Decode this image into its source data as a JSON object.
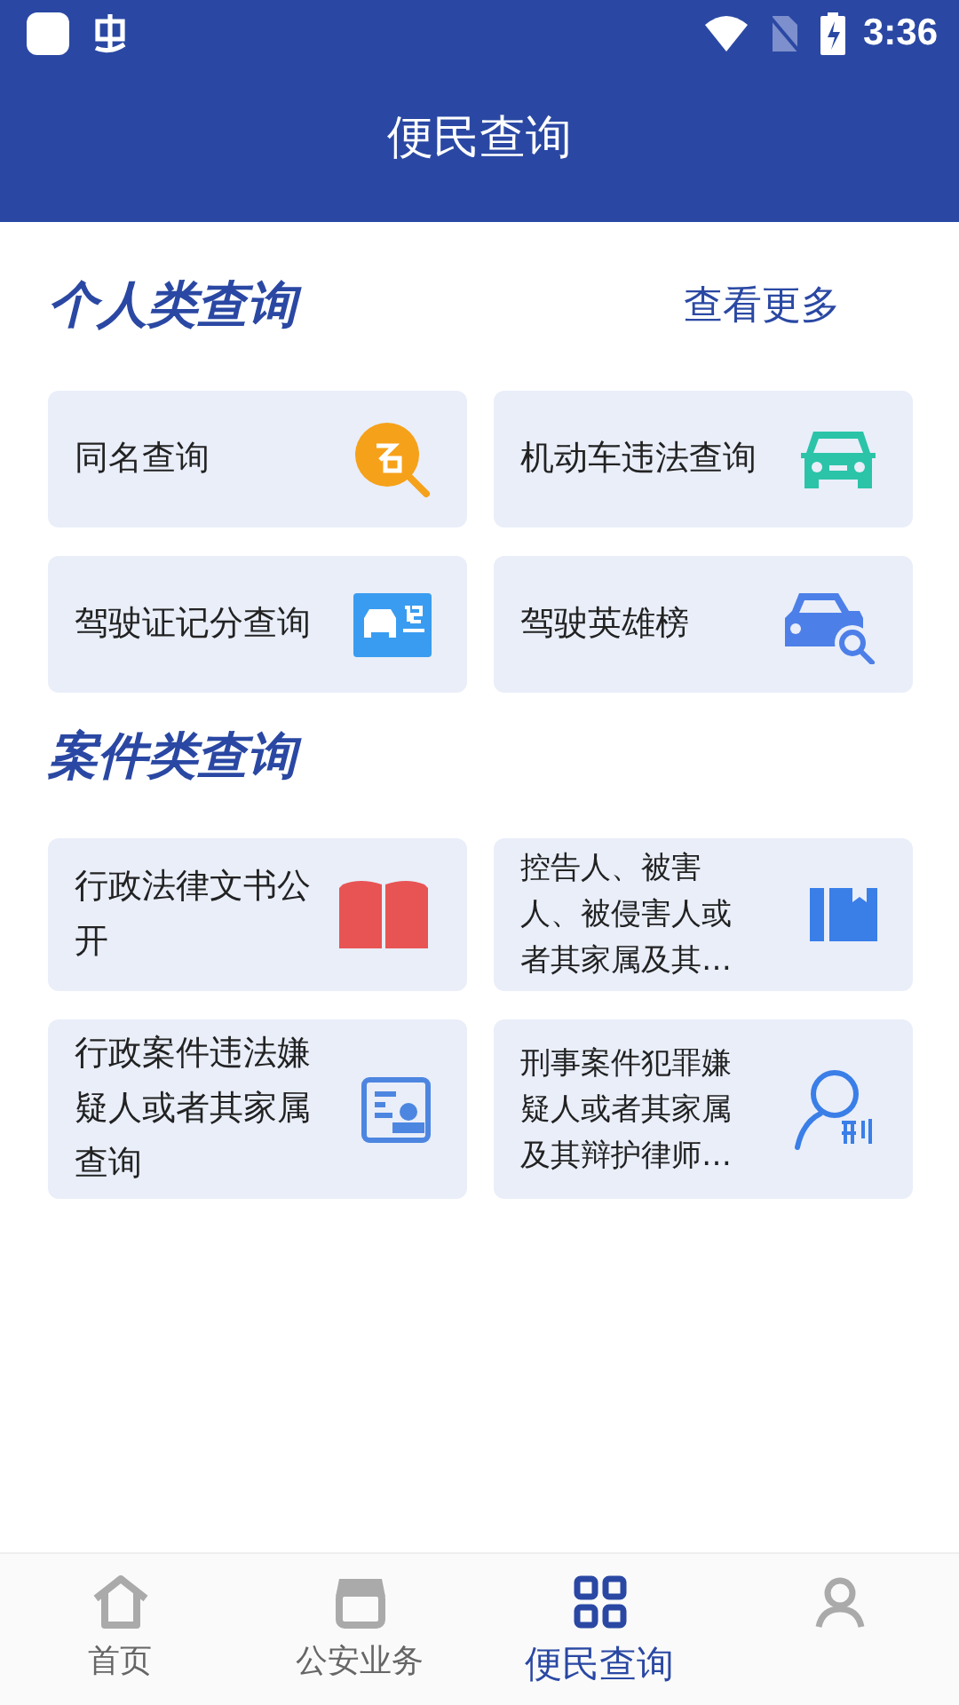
{
  "status_bar": {
    "time": "3:36"
  },
  "header": {
    "title": "便民查询"
  },
  "sections": [
    {
      "title": "个人类查询",
      "more": "查看更多",
      "items": [
        {
          "label": "同名查询",
          "kind": "name-search"
        },
        {
          "label": "机动车违法查询",
          "kind": "car"
        },
        {
          "label": "驾驶证记分查询",
          "kind": "license"
        },
        {
          "label": "驾驶英雄榜",
          "kind": "car-search"
        }
      ]
    },
    {
      "title": "案件类查询",
      "items": [
        {
          "label": "行政法律文书公开",
          "kind": "law-book"
        },
        {
          "label": "控告人、被害人、被侵害人或者其家属及其…",
          "kind": "bookmark",
          "small": true
        },
        {
          "label": "行政案件违法嫌疑人或者其家属查询",
          "kind": "stamp"
        },
        {
          "label": "刑事案件犯罪嫌疑人或者其家属及其辩护律师…",
          "kind": "person-penal",
          "small": true
        }
      ]
    }
  ],
  "tabs": [
    {
      "label": "首页",
      "kind": "home",
      "selected": false
    },
    {
      "label": "公安业务",
      "kind": "shop",
      "selected": false
    },
    {
      "label": "便民查询",
      "kind": "grid",
      "selected": true
    },
    {
      "kind": "person",
      "selected": false
    }
  ]
}
